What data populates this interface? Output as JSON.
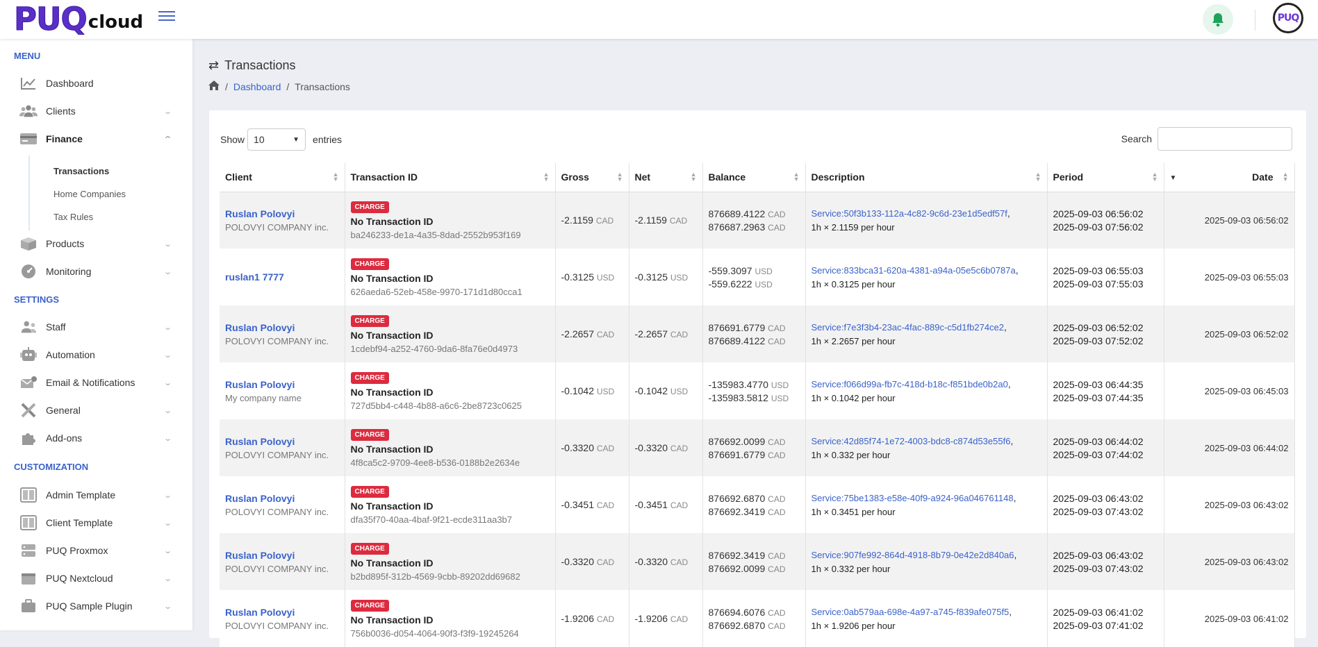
{
  "brand": {
    "logo_main": "PUQ",
    "logo_sub": "cloud",
    "avatar_text": "PUQ"
  },
  "sidebar": {
    "menu_title": "MENU",
    "settings_title": "SETTINGS",
    "customization_title": "CUSTOMIZATION",
    "menu_items": [
      {
        "label": "Dashboard"
      },
      {
        "label": "Clients"
      },
      {
        "label": "Finance"
      },
      {
        "label": "Products"
      },
      {
        "label": "Monitoring"
      }
    ],
    "finance_sub": [
      {
        "label": "Transactions"
      },
      {
        "label": "Home Companies"
      },
      {
        "label": "Tax Rules"
      }
    ],
    "settings_items": [
      {
        "label": "Staff"
      },
      {
        "label": "Automation"
      },
      {
        "label": "Email & Notifications"
      },
      {
        "label": "General"
      },
      {
        "label": "Add-ons"
      }
    ],
    "custom_items": [
      {
        "label": "Admin Template"
      },
      {
        "label": "Client Template"
      },
      {
        "label": "PUQ Proxmox"
      },
      {
        "label": "PUQ Nextcloud"
      },
      {
        "label": "PUQ Sample Plugin"
      }
    ]
  },
  "page": {
    "title": "Transactions",
    "breadcrumb": [
      "Dashboard",
      "Transactions"
    ]
  },
  "table_controls": {
    "show_label": "Show",
    "page_size": "10",
    "entries_label": "entries",
    "search_label": "Search"
  },
  "columns": [
    "Client",
    "Transaction ID",
    "Gross",
    "Net",
    "Balance",
    "Description",
    "Period",
    "Date"
  ],
  "rows": [
    {
      "client": "Ruslan Polovyi",
      "company": "POLOVYI COMPANY inc.",
      "badge": "CHARGE",
      "txid": "No Transaction ID",
      "uuid": "ba246233-de1a-4a35-8dad-2552b953f169",
      "gross": "-2.1159",
      "net": "-2.1159",
      "cur": "CAD",
      "bal1": "876689.4122",
      "bal2": "876687.2963",
      "svc": "Service:50f3b133-112a-4c82-9c6d-23e1d5edf57f",
      "rate": "1h × 2.1159 per hour",
      "p1": "2025-09-03 06:56:02",
      "p2": "2025-09-03 07:56:02",
      "date": "2025-09-03 06:56:02"
    },
    {
      "client": "ruslan1 7777",
      "company": "",
      "badge": "CHARGE",
      "txid": "No Transaction ID",
      "uuid": "626aeda6-52eb-458e-9970-171d1d80cca1",
      "gross": "-0.3125",
      "net": "-0.3125",
      "cur": "USD",
      "bal1": "-559.3097",
      "bal2": "-559.6222",
      "svc": "Service:833bca31-620a-4381-a94a-05e5c6b0787a",
      "rate": "1h × 0.3125 per hour",
      "p1": "2025-09-03 06:55:03",
      "p2": "2025-09-03 07:55:03",
      "date": "2025-09-03 06:55:03"
    },
    {
      "client": "Ruslan Polovyi",
      "company": "POLOVYI COMPANY inc.",
      "badge": "CHARGE",
      "txid": "No Transaction ID",
      "uuid": "1cdebf94-a252-4760-9da6-8fa76e0d4973",
      "gross": "-2.2657",
      "net": "-2.2657",
      "cur": "CAD",
      "bal1": "876691.6779",
      "bal2": "876689.4122",
      "svc": "Service:f7e3f3b4-23ac-4fac-889c-c5d1fb274ce2",
      "rate": "1h × 2.2657 per hour",
      "p1": "2025-09-03 06:52:02",
      "p2": "2025-09-03 07:52:02",
      "date": "2025-09-03 06:52:02"
    },
    {
      "client": "Ruslan Polovyi",
      "company": "My company name",
      "badge": "CHARGE",
      "txid": "No Transaction ID",
      "uuid": "727d5bb4-c448-4b88-a6c6-2be8723c0625",
      "gross": "-0.1042",
      "net": "-0.1042",
      "cur": "USD",
      "bal1": "-135983.4770",
      "bal2": "-135983.5812",
      "svc": "Service:f066d99a-fb7c-418d-b18c-f851bde0b2a0",
      "rate": "1h × 0.1042 per hour",
      "p1": "2025-09-03 06:44:35",
      "p2": "2025-09-03 07:44:35",
      "date": "2025-09-03 06:45:03"
    },
    {
      "client": "Ruslan Polovyi",
      "company": "POLOVYI COMPANY inc.",
      "badge": "CHARGE",
      "txid": "No Transaction ID",
      "uuid": "4f8ca5c2-9709-4ee8-b536-0188b2e2634e",
      "gross": "-0.3320",
      "net": "-0.3320",
      "cur": "CAD",
      "bal1": "876692.0099",
      "bal2": "876691.6779",
      "svc": "Service:42d85f74-1e72-4003-bdc8-c874d53e55f6",
      "rate": "1h × 0.332 per hour",
      "p1": "2025-09-03 06:44:02",
      "p2": "2025-09-03 07:44:02",
      "date": "2025-09-03 06:44:02"
    },
    {
      "client": "Ruslan Polovyi",
      "company": "POLOVYI COMPANY inc.",
      "badge": "CHARGE",
      "txid": "No Transaction ID",
      "uuid": "dfa35f70-40aa-4baf-9f21-ecde311aa3b7",
      "gross": "-0.3451",
      "net": "-0.3451",
      "cur": "CAD",
      "bal1": "876692.6870",
      "bal2": "876692.3419",
      "svc": "Service:75be1383-e58e-40f9-a924-96a046761148",
      "rate": "1h × 0.3451 per hour",
      "p1": "2025-09-03 06:43:02",
      "p2": "2025-09-03 07:43:02",
      "date": "2025-09-03 06:43:02"
    },
    {
      "client": "Ruslan Polovyi",
      "company": "POLOVYI COMPANY inc.",
      "badge": "CHARGE",
      "txid": "No Transaction ID",
      "uuid": "b2bd895f-312b-4569-9cbb-89202dd69682",
      "gross": "-0.3320",
      "net": "-0.3320",
      "cur": "CAD",
      "bal1": "876692.3419",
      "bal2": "876692.0099",
      "svc": "Service:907fe992-864d-4918-8b79-0e42e2d840a6",
      "rate": "1h × 0.332 per hour",
      "p1": "2025-09-03 06:43:02",
      "p2": "2025-09-03 07:43:02",
      "date": "2025-09-03 06:43:02"
    },
    {
      "client": "Ruslan Polovyi",
      "company": "POLOVYI COMPANY inc.",
      "badge": "CHARGE",
      "txid": "No Transaction ID",
      "uuid": "756b0036-d054-4064-90f3-f3f9-19245264",
      "gross": "-1.9206",
      "net": "-1.9206",
      "cur": "CAD",
      "bal1": "876694.6076",
      "bal2": "876692.6870",
      "svc": "Service:0ab579aa-698e-4a97-a745-f839afe075f5",
      "rate": "1h × 1.9206 per hour",
      "p1": "2025-09-03 06:41:02",
      "p2": "2025-09-03 07:41:02",
      "date": "2025-09-03 06:41:02"
    }
  ]
}
